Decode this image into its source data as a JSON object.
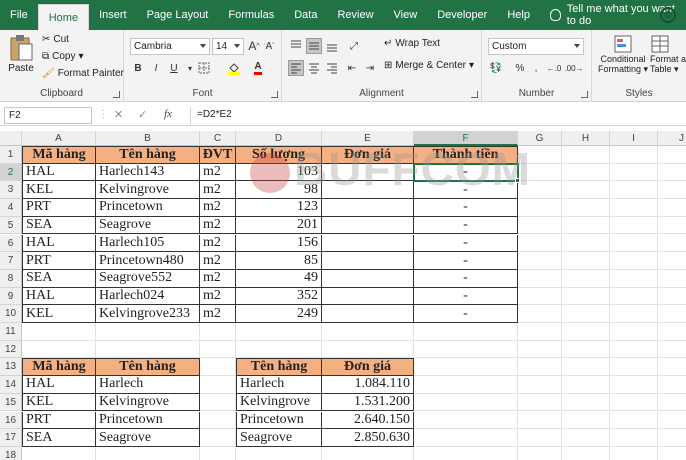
{
  "tabs": [
    "File",
    "Home",
    "Insert",
    "Page Layout",
    "Formulas",
    "Data",
    "Review",
    "View",
    "Developer",
    "Help"
  ],
  "active_tab": "Home",
  "tell_me": "Tell me what you want to do",
  "clipboard": {
    "paste": "Paste",
    "cut": "Cut",
    "copy": "Copy",
    "format_painter": "Format Painter",
    "label": "Clipboard"
  },
  "font": {
    "name": "Cambria",
    "size": "14",
    "grow": "A",
    "shrink": "A",
    "bold": "B",
    "italic": "I",
    "underline": "U",
    "font_color_glyph": "A",
    "label": "Font"
  },
  "alignment": {
    "wrap_text": "Wrap Text",
    "merge_center": "Merge & Center",
    "label": "Alignment"
  },
  "number": {
    "format": "Custom",
    "label": "Number"
  },
  "styles": {
    "conditional": "Conditional",
    "formatting": "Formatting",
    "format_as": "Format a",
    "table": "Table",
    "label": "Styles"
  },
  "name_box": "F2",
  "formula_symbol": "fx",
  "formula": "=D2*E2",
  "watermark": "BUFFCOM",
  "columns": [
    "A",
    "B",
    "C",
    "D",
    "E",
    "F",
    "G",
    "H",
    "I",
    "J"
  ],
  "rows": [
    "1",
    "2",
    "3",
    "4",
    "5",
    "6",
    "7",
    "8",
    "9",
    "10",
    "11",
    "12",
    "13",
    "14",
    "15",
    "16",
    "17",
    "18"
  ],
  "table1": {
    "headers": [
      "Mã hàng",
      "Tên hàng",
      "ĐVT",
      "Số lượng",
      "Đơn giá",
      "Thành tiền"
    ],
    "rows": [
      [
        "HAL",
        "Harlech143",
        "m2",
        "103",
        "",
        "-"
      ],
      [
        "KEL",
        "Kelvingrove",
        "m2",
        "98",
        "",
        "-"
      ],
      [
        "PRT",
        "Princetown",
        "m2",
        "123",
        "",
        "-"
      ],
      [
        "SEA",
        "Seagrove",
        "m2",
        "201",
        "",
        "-"
      ],
      [
        "HAL",
        "Harlech105",
        "m2",
        "156",
        "",
        "-"
      ],
      [
        "PRT",
        "Princetown480",
        "m2",
        "85",
        "",
        "-"
      ],
      [
        "SEA",
        "Seagrove552",
        "m2",
        "49",
        "",
        "-"
      ],
      [
        "HAL",
        "Harlech024",
        "m2",
        "352",
        "",
        "-"
      ],
      [
        "KEL",
        "Kelvingrove233",
        "m2",
        "249",
        "",
        "-"
      ]
    ]
  },
  "table2": {
    "headers": [
      "Mã hàng",
      "Tên hàng"
    ],
    "rows": [
      [
        "HAL",
        "Harlech"
      ],
      [
        "KEL",
        "Kelvingrove"
      ],
      [
        "PRT",
        "Princetown"
      ],
      [
        "SEA",
        "Seagrove"
      ]
    ]
  },
  "table3": {
    "headers": [
      "Tên hàng",
      "Đơn giá"
    ],
    "rows": [
      [
        "Harlech",
        "1.084.110"
      ],
      [
        "Kelvingrove",
        "1.531.200"
      ],
      [
        "Princetown",
        "2.640.150"
      ],
      [
        "Seagrove",
        "2.850.630"
      ]
    ]
  },
  "colors": {
    "accent": "#217346",
    "header_fill": "#f4b083"
  }
}
